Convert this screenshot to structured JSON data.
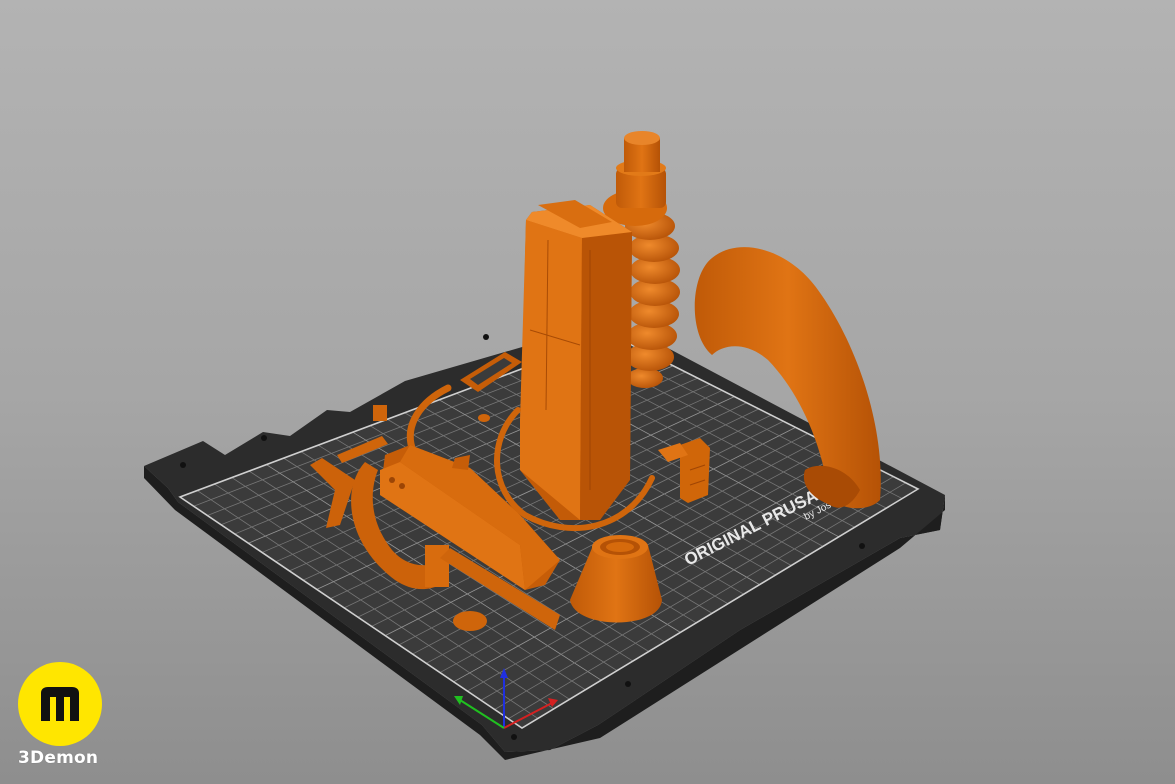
{
  "bed": {
    "label_main": "ORIGINAL PRUSA i3",
    "label_sub": "by Jose"
  },
  "brand": {
    "name": "3Demon",
    "badge_color": "#ffe600"
  },
  "colors": {
    "filament": "#d5660a",
    "filament_dark": "#9c4505",
    "filament_light": "#ee8a2e",
    "bed_frame": "#2e2e2e",
    "bed_surface": "#3c3c3c",
    "grid_line": "#8a8a8a",
    "axis_x": "#d42020",
    "axis_y": "#20c020",
    "axis_z": "#2030e0"
  }
}
